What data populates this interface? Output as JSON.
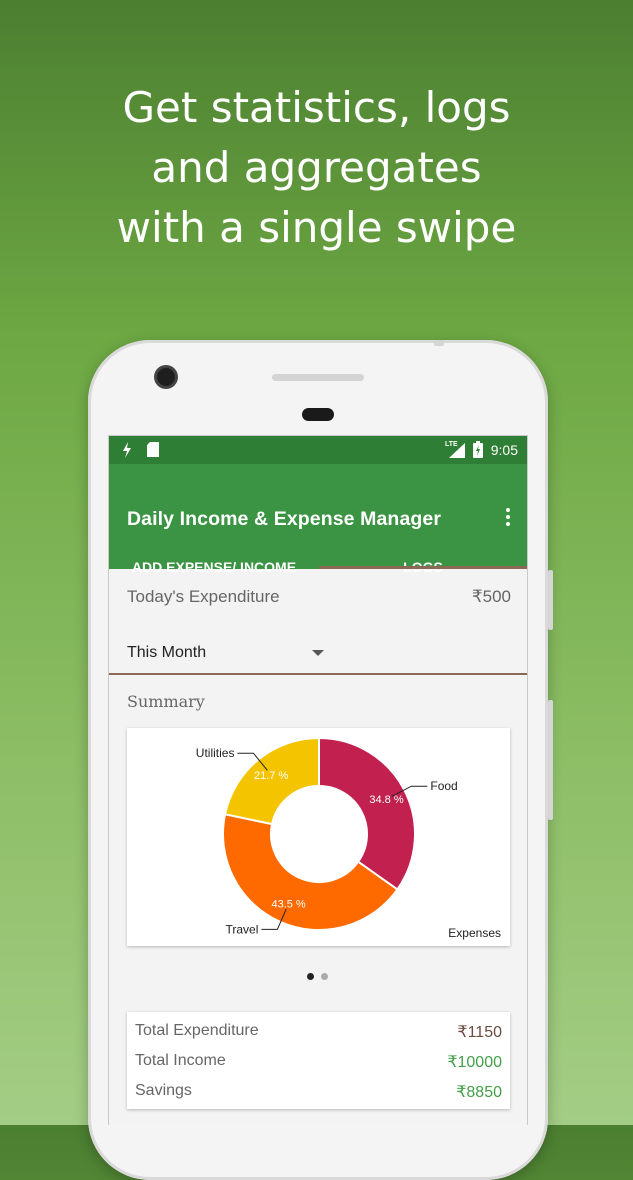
{
  "headline": {
    "line1": "Get statistics, logs",
    "line2": "and aggregates",
    "line3": "with a single swipe"
  },
  "status_bar": {
    "network": "LTE",
    "time": "9:05"
  },
  "app": {
    "title": "Daily Income & Expense Manager",
    "tabs": [
      "ADD EXPENSE/ INCOME",
      "LOGS"
    ],
    "active_tab": "LOGS"
  },
  "today": {
    "label": "Today's Expenditure",
    "value": "₹500"
  },
  "period_select": {
    "selected": "This Month"
  },
  "summary_label": "Summary",
  "chart_data": {
    "type": "pie",
    "donut": true,
    "labels": [
      "Food",
      "Travel",
      "Utilities"
    ],
    "values": [
      34.8,
      43.5,
      21.7
    ],
    "value_labels": [
      "34.8 %",
      "43.5 %",
      "21.7 %"
    ],
    "colors": [
      "#c2214f",
      "#ff6a00",
      "#f5c400"
    ],
    "description": "Expenses"
  },
  "pager": {
    "count": 2,
    "active": 0
  },
  "totals": {
    "rows": [
      {
        "label": "Total Expenditure",
        "value": "₹1150",
        "color": "#6d4c41"
      },
      {
        "label": "Total Income",
        "value": "₹10000",
        "color": "#43a047"
      },
      {
        "label": "Savings",
        "value": "₹8850",
        "color": "#43a047"
      }
    ]
  },
  "colors": {
    "primary": "#3b9443",
    "primary_dark": "#2e7f35",
    "accent": "#8a6a55"
  }
}
